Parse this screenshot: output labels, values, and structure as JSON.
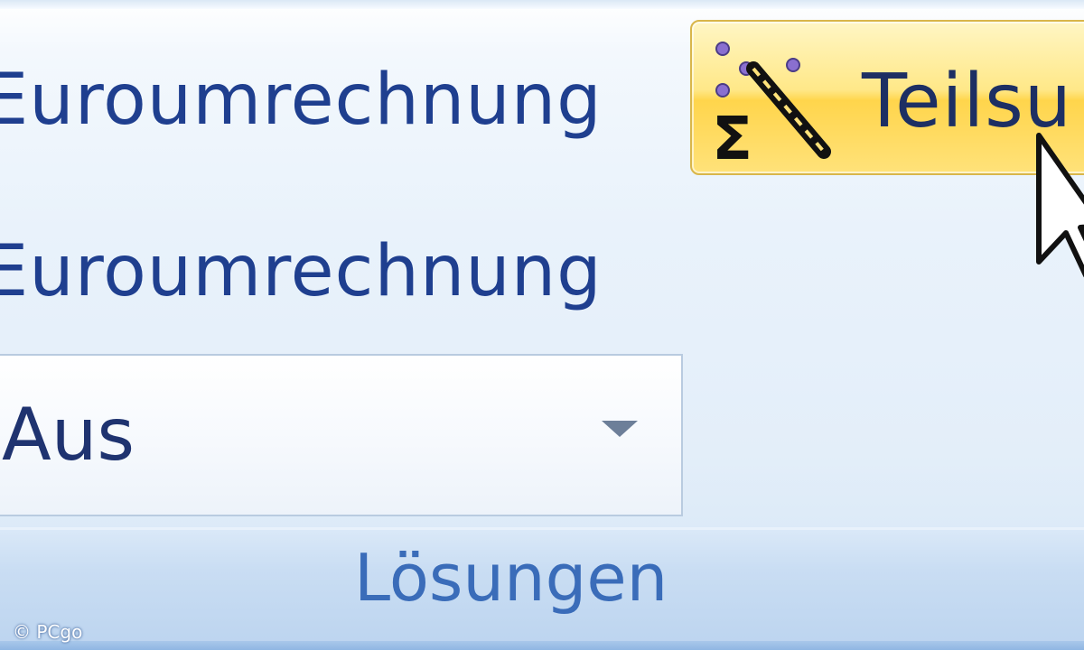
{
  "commands": [
    {
      "label": "Euroumrechnung"
    },
    {
      "label": "Euroumrechnung"
    }
  ],
  "subtotal_button": {
    "label": "Teilsu",
    "icon": "subtotal-sigma-icon"
  },
  "dropdown": {
    "value": "Aus"
  },
  "group": {
    "label": "Lösungen"
  },
  "watermark": {
    "text": "© PCgo"
  },
  "colors": {
    "ribbon_text": "#1f3f8f",
    "group_label": "#3a6cb9",
    "hover_button": "#ffe27a",
    "hover_border": "#d9b64a"
  }
}
